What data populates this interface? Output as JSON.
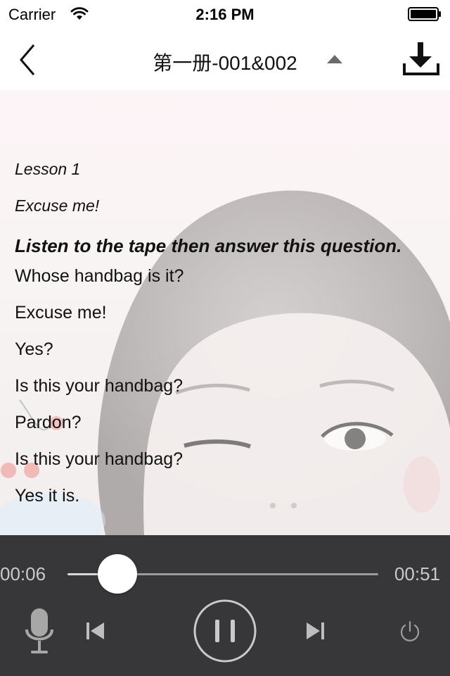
{
  "status_bar": {
    "carrier": "Carrier",
    "time": "2:16 PM",
    "icons": [
      "wifi-icon",
      "battery-icon"
    ]
  },
  "nav": {
    "title": "第一册-001&002",
    "icons": [
      "chevron-left-icon",
      "triangle-up-icon",
      "download-icon"
    ]
  },
  "lesson": {
    "number": "Lesson 1",
    "subtitle": "Excuse me!",
    "prompt": "Listen to the tape then answer this question.",
    "lines": [
      "Whose handbag is it?",
      "Excuse me!",
      "Yes?",
      "Is this your handbag?",
      "Pardon?",
      "Is this your handbag?",
      "Yes it is."
    ]
  },
  "player": {
    "current_time": "00:06",
    "total_time": "00:51",
    "progress": 0.16,
    "icons": [
      "microphone-icon",
      "skip-previous-icon",
      "pause-icon",
      "skip-next-icon",
      "power-icon"
    ]
  },
  "colors": {
    "player_bg": "#37373a",
    "player_text": "#c9c9c9",
    "content_bg": "#f8f4f4"
  }
}
